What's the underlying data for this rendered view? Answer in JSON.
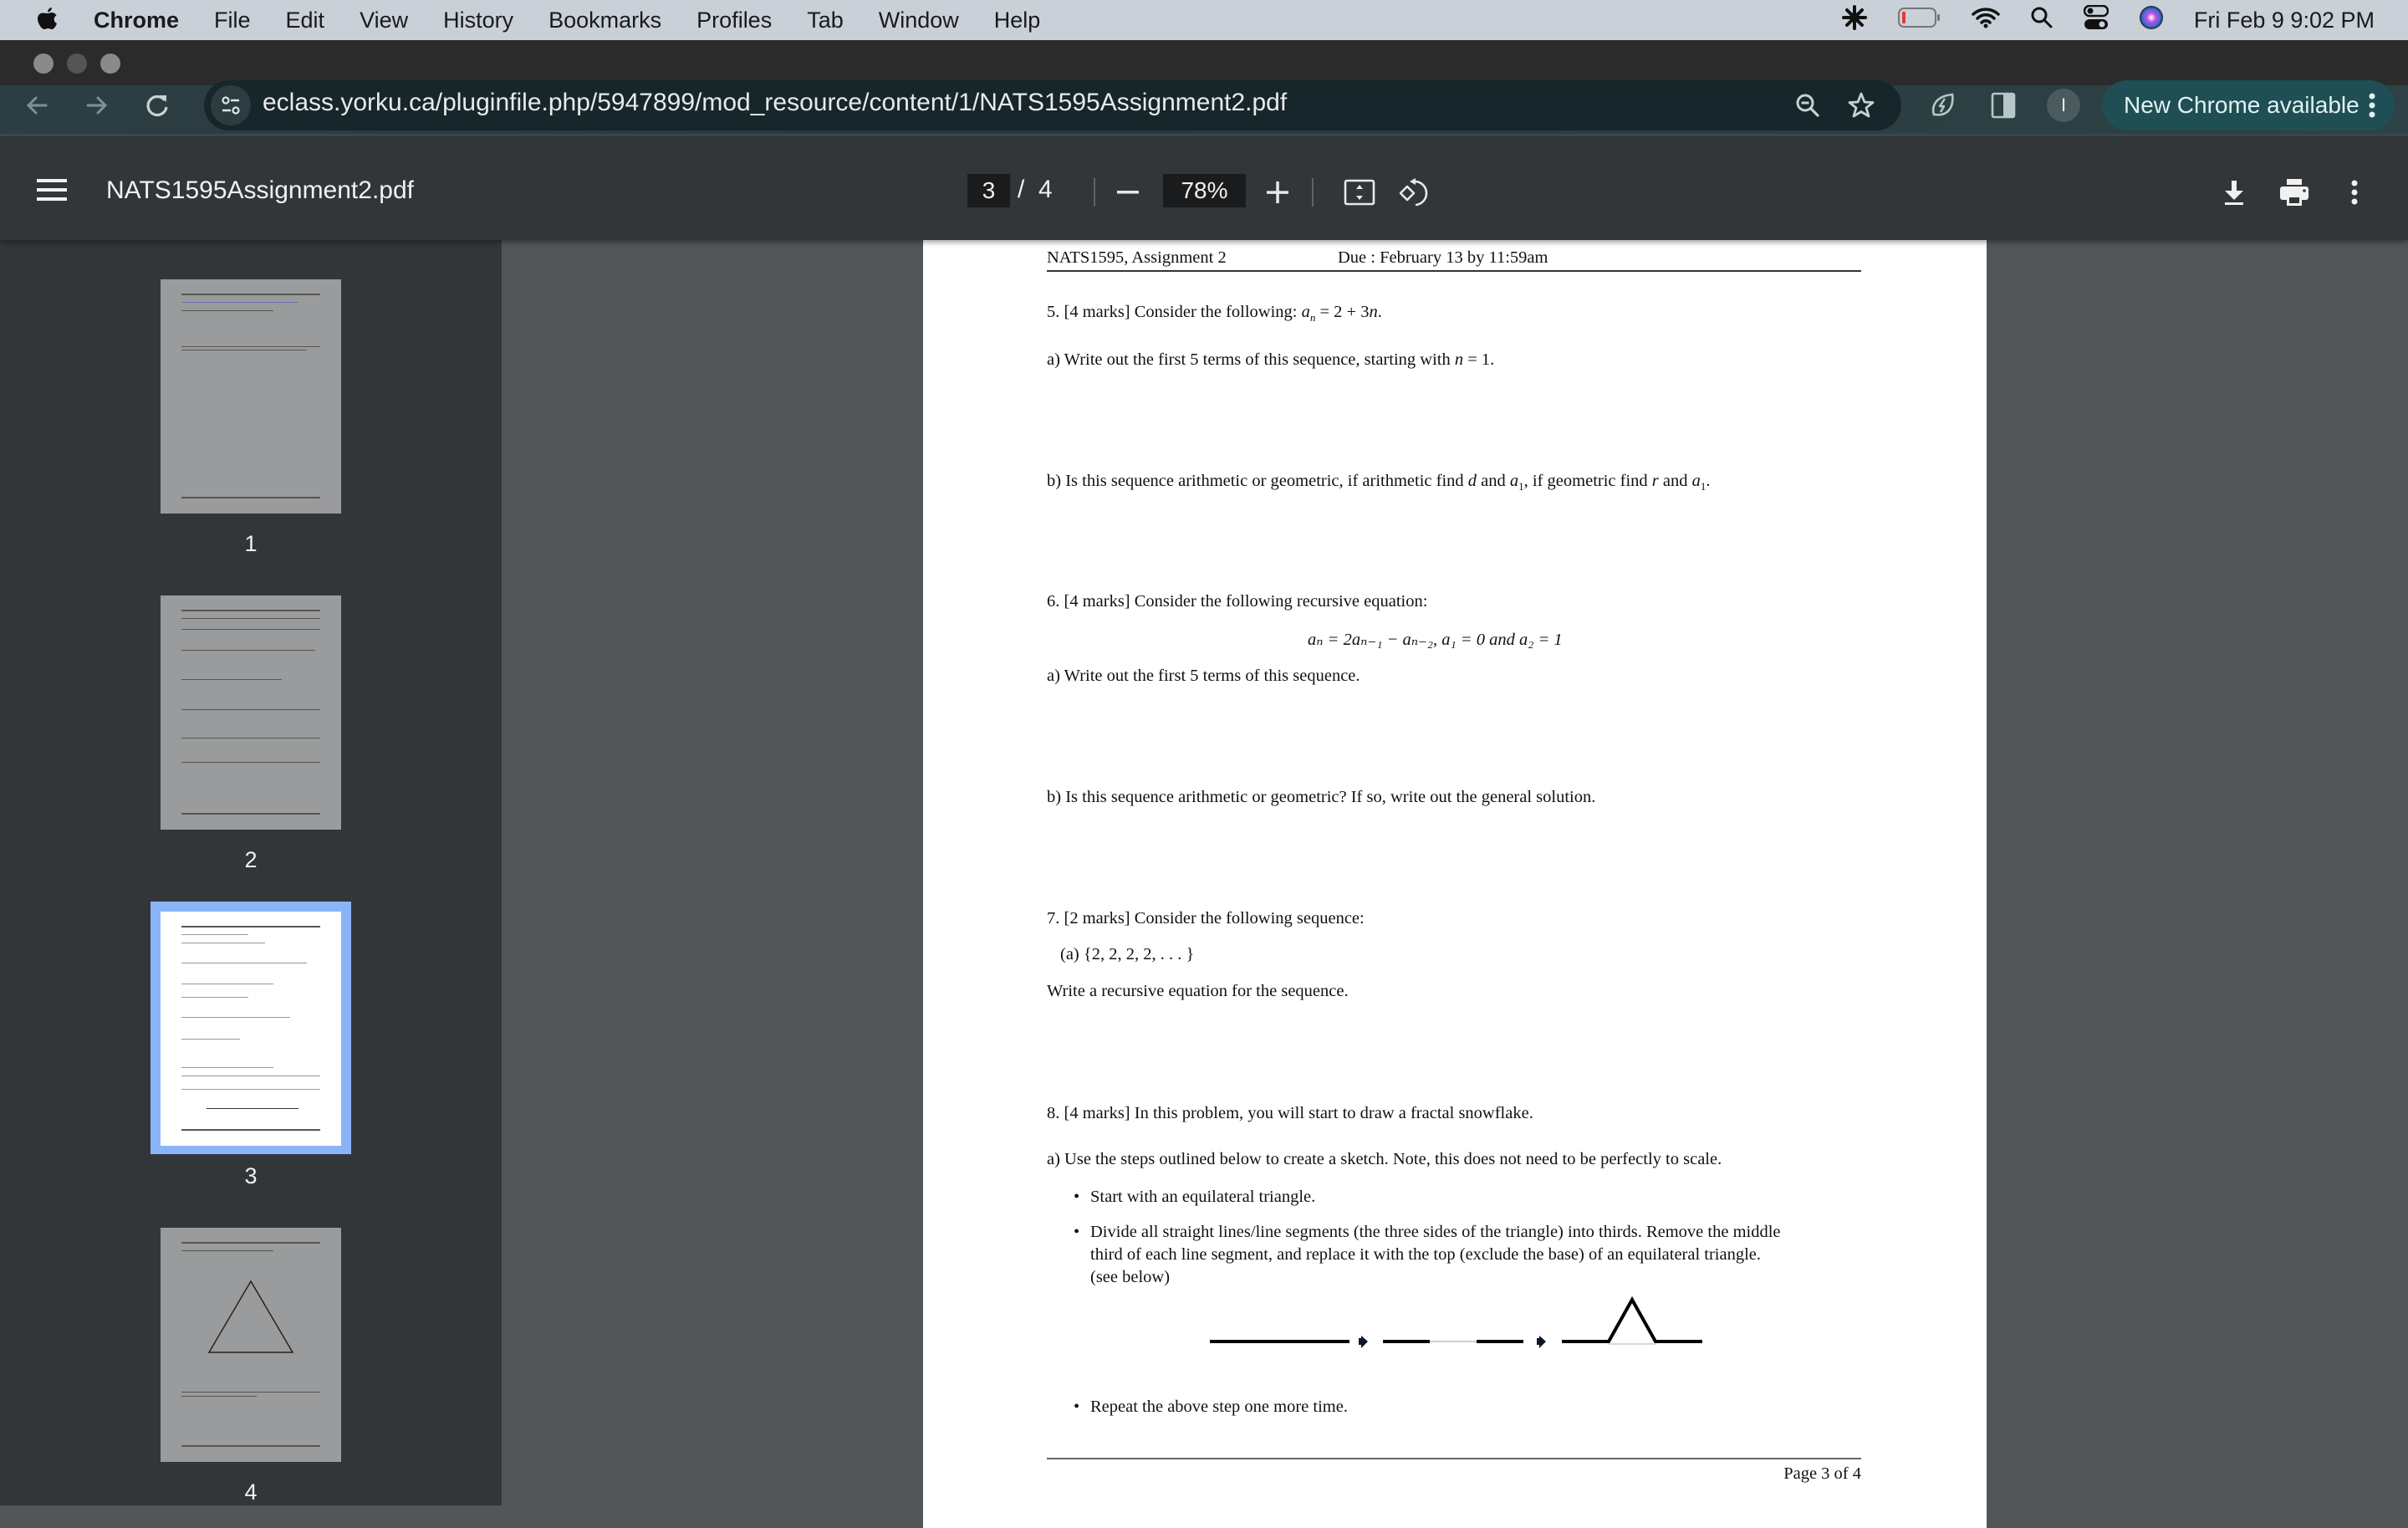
{
  "menubar": {
    "app_name": "Chrome",
    "items": [
      "File",
      "Edit",
      "View",
      "History",
      "Bookmarks",
      "Profiles",
      "Tab",
      "Window",
      "Help"
    ],
    "clock": "Fri Feb 9  9:02 PM",
    "status_icons": [
      "gear-asterisk-icon",
      "battery-low-icon",
      "wifi-icon",
      "spotlight-search-icon",
      "control-center-icon",
      "siri-icon"
    ],
    "battery_level_fraction": 0.1
  },
  "browser": {
    "url": "eclass.yorku.ca/pluginfile.php/5947899/mod_resource/content/1/NATS1595Assignment2.pdf",
    "profile_initial": "I",
    "update_label": "New Chrome available"
  },
  "pdf_toolbar": {
    "title": "NATS1595Assignment2.pdf",
    "current_page": "3",
    "page_separator": "/",
    "total_pages": "4",
    "zoom": "78%"
  },
  "sidebar": {
    "thumbnails": [
      {
        "label": "1",
        "active": false
      },
      {
        "label": "2",
        "active": false
      },
      {
        "label": "3",
        "active": true
      },
      {
        "label": "4",
        "active": false
      }
    ]
  },
  "page": {
    "header_left": "NATS1595, Assignment 2",
    "header_right": "Due : February 13 by 11:59am",
    "q5": {
      "stem": "5. [4 marks] Consider the following: ",
      "formula_var": "a",
      "formula_sub": "n",
      "formula_rest": " = 2 + 3",
      "formula_n": "n",
      "formula_end": ".",
      "a_text": "a) Write out the first 5 terms of this sequence, starting with ",
      "a_var": "n",
      "a_end": " = 1.",
      "b_text1": "b) Is this sequence arithmetic or geometric, if arithmetic find ",
      "b_d": "d",
      "b_text2": " and ",
      "b_text3": ", if geometric find ",
      "b_r": "r",
      "b_text4": " and ",
      "b_end": "."
    },
    "q6": {
      "stem": "6. [4 marks] Consider the following recursive equation:",
      "equation": "aₙ = 2aₙ₋₁ − aₙ₋₂, a₁ = 0 and a₂ = 1",
      "a_text": "a) Write out the first 5 terms of this sequence.",
      "b_text": "b) Is this sequence arithmetic or geometric? If so, write out the general solution."
    },
    "q7": {
      "stem": "7. [2 marks] Consider the following sequence:",
      "item": "(a)  {2, 2, 2, 2, . . . }",
      "instruction": "Write a recursive equation for the sequence."
    },
    "q8": {
      "stem": "8. [4 marks] In this problem, you will start to draw a fractal snowflake.",
      "a_text": "a) Use the steps outlined below to create a sketch. Note, this does not need to be perfectly to scale.",
      "bullet1": "Start with an equilateral triangle.",
      "bullet2_line1": "Divide all straight lines/line segments (the three sides of the triangle) into thirds. Remove the middle",
      "bullet2_line2": "third of each line segment, and replace it with the top (exclude the base) of an equilateral triangle.",
      "bullet2_line3": "(see below)",
      "bullet3": "Repeat the above step one more time."
    },
    "footer": "Page 3 of 4"
  }
}
